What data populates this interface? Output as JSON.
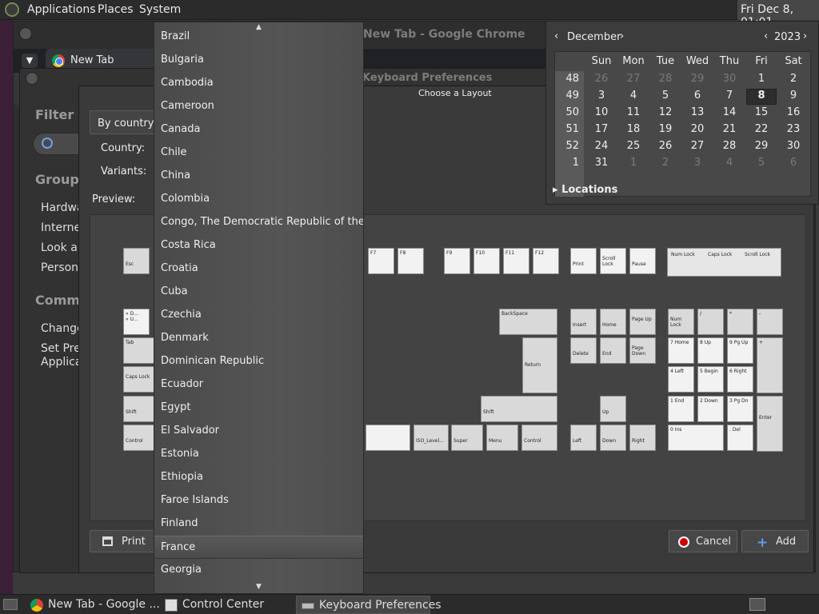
{
  "top_panel": {
    "menus": [
      "Applications",
      "Places",
      "System"
    ],
    "clock": "Fri Dec 8, 01:01"
  },
  "chrome": {
    "title": "New Tab - Google Chrome",
    "tab_label": "New Tab"
  },
  "control_center": {
    "title": "Keyboard Preferences",
    "filter_label": "Filter",
    "groups_label": "Groups",
    "group_items": [
      "Hardwa",
      "Internet",
      "Look an",
      "Persona"
    ],
    "common_label": "Commo",
    "common_items": [
      "Change",
      "Set Pref",
      "Applicat"
    ]
  },
  "layout_dialog": {
    "title": "Choose a Layout",
    "by_country": "By country",
    "country_label": "Country:",
    "variants_label": "Variants:",
    "preview_label": "Preview:",
    "print_label": "Print",
    "cancel_label": "Cancel",
    "add_label": "Add"
  },
  "country_list": {
    "options": [
      "Brazil",
      "Bulgaria",
      "Cambodia",
      "Cameroon",
      "Canada",
      "Chile",
      "China",
      "Colombia",
      "Congo, The Democratic Republic of the",
      "Costa Rica",
      "Croatia",
      "Cuba",
      "Czechia",
      "Denmark",
      "Dominican Republic",
      "Ecuador",
      "Egypt",
      "El Salvador",
      "Estonia",
      "Ethiopia",
      "Faroe Islands",
      "Finland",
      "France",
      "Georgia"
    ],
    "selected": "France",
    "scroll_up": "▲",
    "scroll_down": "▼"
  },
  "calendar": {
    "month": "December",
    "year": "2023",
    "prev": "‹",
    "next": "›",
    "weekdays": [
      "Sun",
      "Mon",
      "Tue",
      "Wed",
      "Thu",
      "Fri",
      "Sat"
    ],
    "weeks": [
      {
        "wk": "48",
        "days": [
          "26",
          "27",
          "28",
          "29",
          "30",
          "1",
          "2"
        ],
        "dim": [
          true,
          true,
          true,
          true,
          true,
          false,
          false
        ]
      },
      {
        "wk": "49",
        "days": [
          "3",
          "4",
          "5",
          "6",
          "7",
          "8",
          "9"
        ],
        "dim": [
          false,
          false,
          false,
          false,
          false,
          false,
          false
        ]
      },
      {
        "wk": "50",
        "days": [
          "10",
          "11",
          "12",
          "13",
          "14",
          "15",
          "16"
        ],
        "dim": [
          false,
          false,
          false,
          false,
          false,
          false,
          false
        ]
      },
      {
        "wk": "51",
        "days": [
          "17",
          "18",
          "19",
          "20",
          "21",
          "22",
          "23"
        ],
        "dim": [
          false,
          false,
          false,
          false,
          false,
          false,
          false
        ]
      },
      {
        "wk": "52",
        "days": [
          "24",
          "25",
          "26",
          "27",
          "28",
          "29",
          "30"
        ],
        "dim": [
          false,
          false,
          false,
          false,
          false,
          false,
          false
        ]
      },
      {
        "wk": "1",
        "days": [
          "31",
          "1",
          "2",
          "3",
          "4",
          "5",
          "6"
        ],
        "dim": [
          false,
          true,
          true,
          true,
          true,
          true,
          true
        ]
      }
    ],
    "today": "8",
    "locations_label": "Locations"
  },
  "keyboard": {
    "fkeys": [
      "Esc",
      "F7",
      "F8",
      "F9",
      "F10",
      "F11",
      "F12",
      "Print",
      "Scroll Lock",
      "Pause"
    ],
    "locks": [
      "Num Lock",
      "Caps Lock",
      "Scroll Lock"
    ],
    "nav": [
      "Insert",
      "Home",
      "Page Up",
      "Delete",
      "End",
      "Page Down",
      "Up",
      "Left",
      "Down",
      "Right"
    ],
    "main": [
      "BackSpace",
      "Tab",
      "Return",
      "Caps Lock",
      "Shift",
      "Shift",
      "Control",
      "ISO_Level...",
      "Super",
      "Menu",
      "Control"
    ],
    "numpad": [
      "Num Lock",
      "/",
      "*",
      "-",
      "7 Home",
      "8 Up",
      "9 Pg Up",
      "+",
      "4 Left",
      "5 Begin",
      "6 Right",
      "1 End",
      "2 Down",
      "3 Pg Dn",
      "Enter",
      "0 Ins",
      ". Del"
    ]
  },
  "taskbar": {
    "tasks": [
      "New Tab - Google ...",
      "Control Center",
      "Keyboard Preferences"
    ],
    "active": "Keyboard Preferences"
  }
}
